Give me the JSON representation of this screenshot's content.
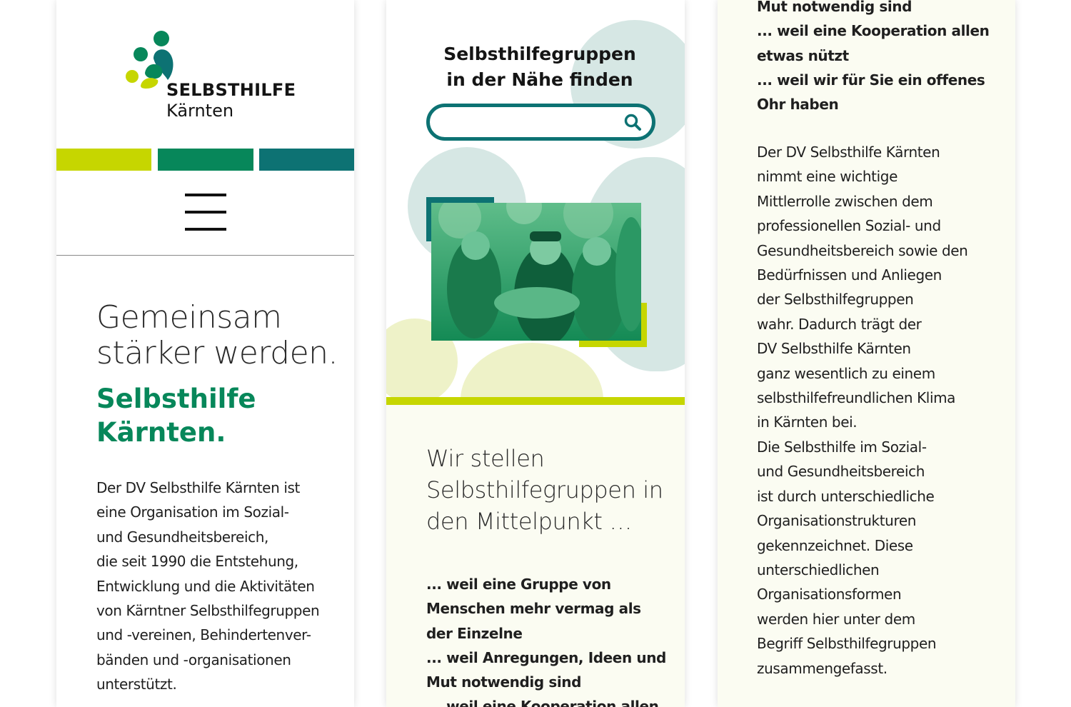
{
  "colors": {
    "lime": "#c6d600",
    "green": "#07875a",
    "teal": "#0d7273",
    "pale_teal": "#d6e7e4",
    "pale_lime": "#eef2c8",
    "cream": "#fbfcf2"
  },
  "panel1": {
    "logo": {
      "title": "SELBSTHILFE",
      "subtitle": "Kärnten",
      "icon": "people-group-logo-icon"
    },
    "menu_icon": "hamburger-menu-icon",
    "headline": "Gemeinsam stärker werden.",
    "subheadline": "Selbsthilfe Kärnten.",
    "body": "Der DV Selbsthilfe Kärnten ist\neine Organisation im Sozial-\nund Gesundheitsbereich,\ndie seit 1990 die Entstehung,\nEntwicklung und die Aktivitäten\nvon Kärntner Selbsthilfegruppen\nund -vereinen, Behindertenver-\nbänden und -organisationen\nunterstützt."
  },
  "panel2": {
    "search_title": "Selbsthilfegruppen\nin der Nähe finden",
    "search_placeholder": "",
    "search_icon": "magnifier-icon",
    "photo_icon": "group-photo-hands-together",
    "subhead": "Wir stellen Selbsthilfegruppen in den Mittelpunkt …",
    "reasons": "... weil eine Gruppe von\nMenschen mehr vermag als\nder Einzelne\n... weil Anregungen, Ideen und\nMut notwendig sind\n... weil eine Kooperation allen"
  },
  "panel3": {
    "reasons": "Mut notwendig sind\n... weil eine Kooperation allen\netwas nützt\n... weil wir für Sie ein offenes\nOhr haben",
    "body": "Der DV Selbsthilfe Kärnten\nnimmt eine wichtige\nMittlerrolle zwischen dem\nprofessionellen Sozial- und\nGesundheitsbereich sowie den\nBedürfnissen und Anliegen\nder Selbsthilfegruppen\nwahr. Dadurch trägt der\nDV Selbsthilfe Kärnten\nganz wesentlich zu einem\nselbsthilfefreundlichen Klima\nin Kärnten bei.\nDie Selbsthilfe im Sozial-\nund Gesundheitsbereich\nist durch unterschiedliche\nOrganisationstrukturen\ngekennzeichnet. Diese\nunterschiedlichen\nOrganisationsformen\nwerden hier unter dem\nBegriff  Selbsthilfegruppen\nzusammengefasst."
  }
}
